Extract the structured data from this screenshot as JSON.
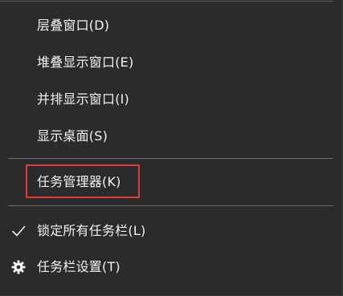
{
  "context_menu": {
    "items": [
      {
        "label": "层叠窗口(D)"
      },
      {
        "label": "堆叠显示窗口(E)"
      },
      {
        "label": "并排显示窗口(I)"
      },
      {
        "label": "显示桌面(S)"
      },
      {
        "label": "任务管理器(K)"
      },
      {
        "label": "锁定所有任务栏(L)",
        "icon": "checkmark-icon",
        "checked": true
      },
      {
        "label": "任务栏设置(T)",
        "icon": "gear-icon"
      }
    ],
    "highlighted_item": "任务管理器(K)",
    "colors": {
      "background": "#2b2b2b",
      "text": "#f2f2f2",
      "separator": "#6b6b6b",
      "highlight_border": "#e23a3a"
    }
  }
}
